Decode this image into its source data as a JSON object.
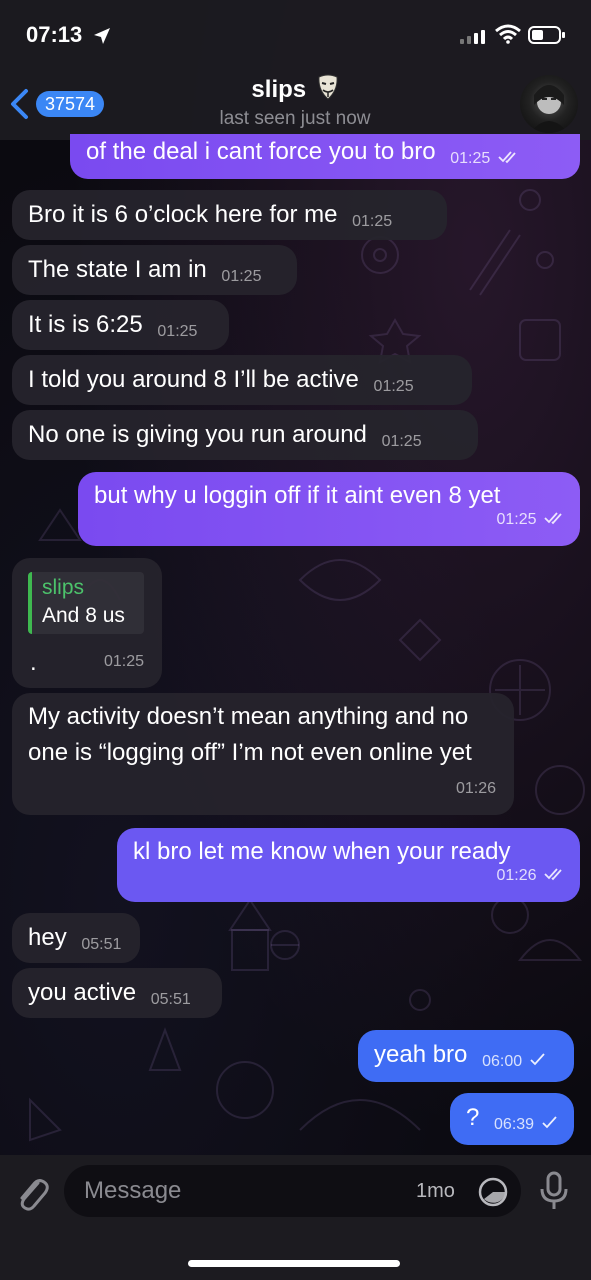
{
  "status_bar": {
    "time": "07:13"
  },
  "header": {
    "back_count": "37574",
    "title": "slips",
    "subtitle": "last seen just now"
  },
  "messages": [
    {
      "direction": "out",
      "text": "of the deal i cant force you to bro",
      "time": "01:25",
      "status": "read"
    },
    {
      "direction": "in",
      "text": "Bro it is 6 o’clock here for me",
      "time": "01:25"
    },
    {
      "direction": "in",
      "text": "The state I am in",
      "time": "01:25"
    },
    {
      "direction": "in",
      "text": "It is is 6:25",
      "time": "01:25"
    },
    {
      "direction": "in",
      "text": "I told you around 8 I’ll be active",
      "time": "01:25"
    },
    {
      "direction": "in",
      "text": "No one is giving you run around",
      "time": "01:25"
    },
    {
      "direction": "out",
      "text": "but why u loggin off if it aint even 8 yet",
      "time": "01:25",
      "status": "read"
    },
    {
      "direction": "in",
      "reply_to": {
        "name": "slips",
        "text": "And 8 us"
      },
      "text": ".",
      "time": "01:25"
    },
    {
      "direction": "in",
      "text": "My activity doesn’t mean anything and no one is “logging off” I’m not even online yet",
      "time": "01:26"
    },
    {
      "direction": "out",
      "text": "kl bro let me know when your ready",
      "time": "01:26",
      "status": "read"
    },
    {
      "direction": "in",
      "text": "hey",
      "time": "05:51"
    },
    {
      "direction": "in",
      "text": "you active",
      "time": "05:51"
    },
    {
      "direction": "out",
      "text": "yeah bro",
      "time": "06:00",
      "status": "sent"
    },
    {
      "direction": "out",
      "text": "?",
      "time": "06:39",
      "status": "sent"
    }
  ],
  "input": {
    "placeholder": "Message",
    "timer_label": "1mo"
  },
  "colors": {
    "accent": "#3b87f5",
    "outgoing_top": "#8d5cf5",
    "outgoing_bottom": "#3f6cf4",
    "incoming": "#26242c",
    "reply_accent": "#3fb950"
  }
}
